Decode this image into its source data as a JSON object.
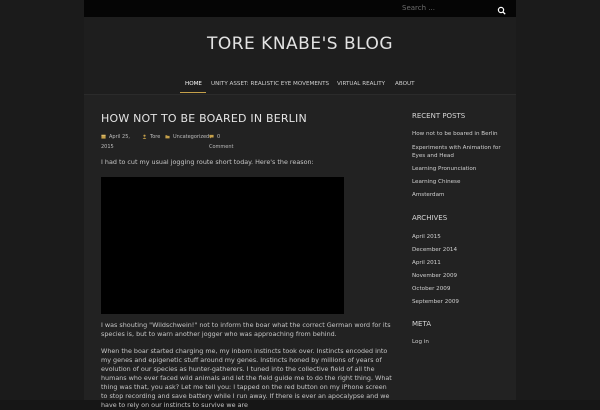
{
  "search": {
    "placeholder": "Search ..."
  },
  "site": {
    "title": "TORE KNABE'S BLOG"
  },
  "nav": {
    "items": [
      {
        "label": "HOME"
      },
      {
        "label": "UNITY ASSET: REALISTIC EYE MOVEMENTS"
      },
      {
        "label": "VIRTUAL REALITY"
      },
      {
        "label": "ABOUT"
      }
    ]
  },
  "post": {
    "title": "HOW NOT TO BE BOARED IN BERLIN",
    "date_line1": "April 25,",
    "date_line2": "2015",
    "author": "Tore",
    "category": "Uncategorized",
    "comments_count": "0",
    "comments_label": "Comment",
    "paragraph1": "I had to cut my usual jogging route short today. Here's the reason:",
    "paragraph2": "I was shouting \"Wildschwein!\" not to inform the boar what the correct German word for its species is, but to warn another jogger who was approaching from behind.",
    "paragraph3": "When the boar started charging me, my inborn instincts took over. Instincts encoded into my genes and epigenetic stuff around my genes. Instincts honed by millions of years of evolution of our species as hunter-gatherers. I tuned into the collective field of all the humans who ever faced wild animals and let the field guide me to do the right thing. What thing was that, you ask? Let me tell you: I tapped on the red button on my iPhone screen to stop recording and save battery while I run away. If there is ever an apocalypse and we have to rely on our instincts to survive we are"
  },
  "sidebar": {
    "recent_posts": {
      "title": "RECENT POSTS",
      "items": [
        "How not to be boared in Berlin",
        "Experiments with Animation for Eyes and Head",
        "Learning Pronunciation",
        "Learning Chinese",
        "Amsterdam"
      ]
    },
    "archives": {
      "title": "ARCHIVES",
      "items": [
        "April 2015",
        "December 2014",
        "April 2011",
        "November 2009",
        "October 2009",
        "September 2009"
      ]
    },
    "meta": {
      "title": "META",
      "items": [
        "Log in"
      ]
    }
  }
}
